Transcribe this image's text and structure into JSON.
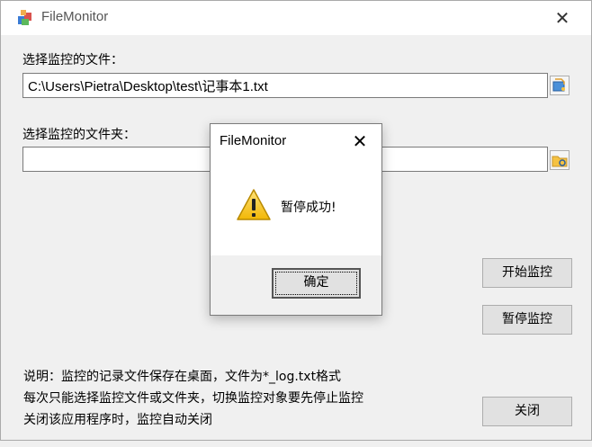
{
  "window": {
    "title": "FileMonitor",
    "close_glyph": "✕"
  },
  "file_section": {
    "label": "选择监控的文件：",
    "path_value": "C:\\Users\\Pietra\\Desktop\\test\\记事本1.txt"
  },
  "folder_section": {
    "label": "选择监控的文件夹：",
    "path_value": ""
  },
  "buttons": {
    "start": "开始监控",
    "pause": "暂停监控",
    "close": "关闭"
  },
  "info": {
    "line1": "说明：监控的记录文件保存在桌面，文件为*_log.txt格式",
    "line2": "每次只能选择监控文件或文件夹，切换监控对象要先停止监控",
    "line3": "关闭该应用程序时，监控自动关闭"
  },
  "dialog": {
    "title": "FileMonitor",
    "close_glyph": "✕",
    "message": "暂停成功!",
    "ok_label": "确定",
    "icon": "warning-icon"
  },
  "colors": {
    "window_bg": "#f0f0f0",
    "warning_yellow": "#f2c21b"
  }
}
